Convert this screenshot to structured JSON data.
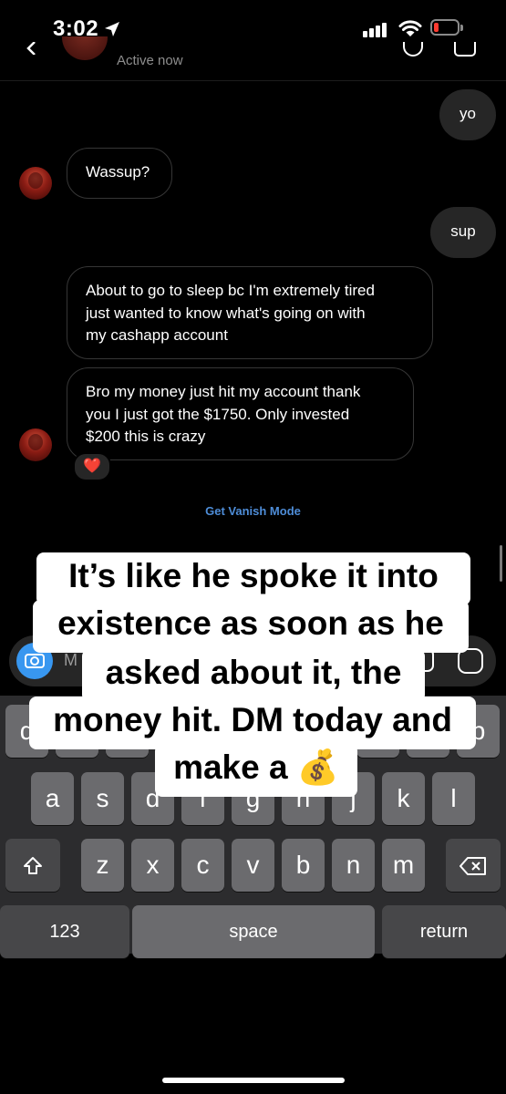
{
  "status_bar": {
    "time": "3:02"
  },
  "header": {
    "status": "Active now"
  },
  "messages": [
    {
      "sender": "me",
      "text": "yo"
    },
    {
      "sender": "them",
      "text": "Wassup?"
    },
    {
      "sender": "me",
      "text": "sup"
    },
    {
      "sender": "them",
      "lines": [
        "About to go to sleep bc I'm extremely tired",
        "just wanted to know what's going on with",
        "my cashapp account"
      ]
    },
    {
      "sender": "them",
      "lines": [
        "Bro my money just hit my account thank",
        "you I just got the $1750. Only invested",
        "$200 this is crazy"
      ],
      "reaction": "❤️"
    }
  ],
  "vanish_mode": "Get Vanish Mode",
  "composer": {
    "partial_placeholder": "M"
  },
  "keyboard": {
    "row1": [
      "q",
      "w",
      "e",
      "r",
      "t",
      "y",
      "u",
      "i",
      "o",
      "p"
    ],
    "row2": [
      "a",
      "s",
      "d",
      "f",
      "g",
      "h",
      "j",
      "k",
      "l"
    ],
    "row3": [
      "z",
      "x",
      "c",
      "v",
      "b",
      "n",
      "m"
    ],
    "numbers_key": "123",
    "space_key": "space",
    "return_key": "return"
  },
  "caption": {
    "lines": [
      "It’s like he spoke it into",
      "existence as soon as he",
      "asked about it, the",
      "money hit. DM today and",
      "make a 💰"
    ]
  }
}
